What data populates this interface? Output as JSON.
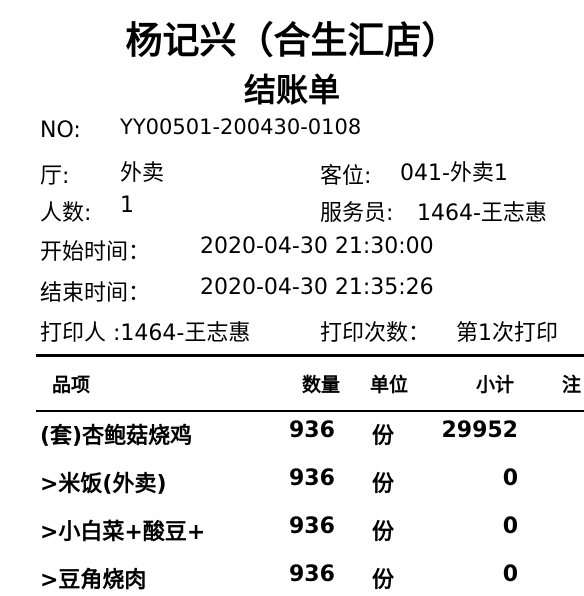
{
  "receipt": {
    "restaurant": "杨记兴（合生汇店）",
    "doc_title": "结账单",
    "no_label": "NO:",
    "no_value": "YY00501-200430-0108",
    "hall_label": "厅:",
    "hall_value": "外卖",
    "seat_label": "客位:",
    "seat_value": "041-外卖1",
    "guests_label": "人数:",
    "guests_value": "1",
    "waiter_label": "服务员:",
    "waiter_value": "1464-王志惠",
    "start_label": "开始时间：",
    "start_value": "2020-04-30 21:30:00",
    "end_label": "结束时间：",
    "end_value": "2020-04-30 21:35:26",
    "printer_text": "打印人 :1464-王志惠",
    "print_count_label": "打印次数：",
    "print_count_value": "第1次打印"
  },
  "table": {
    "headers": {
      "item": "品项",
      "qty": "数量",
      "unit": "单位",
      "subtotal": "小计",
      "note": "注"
    },
    "rows": [
      {
        "item": "(套)杏鲍菇烧鸡",
        "qty": "936",
        "unit": "份",
        "subtotal": "29952"
      },
      {
        "item": ">米饭(外卖)",
        "qty": "936",
        "unit": "份",
        "subtotal": "0"
      },
      {
        "item": ">小白菜+酸豆+",
        "qty": "936",
        "unit": "份",
        "subtotal": "0"
      },
      {
        "item": ">豆角烧肉",
        "qty": "936",
        "unit": "份",
        "subtotal": "0"
      }
    ]
  }
}
